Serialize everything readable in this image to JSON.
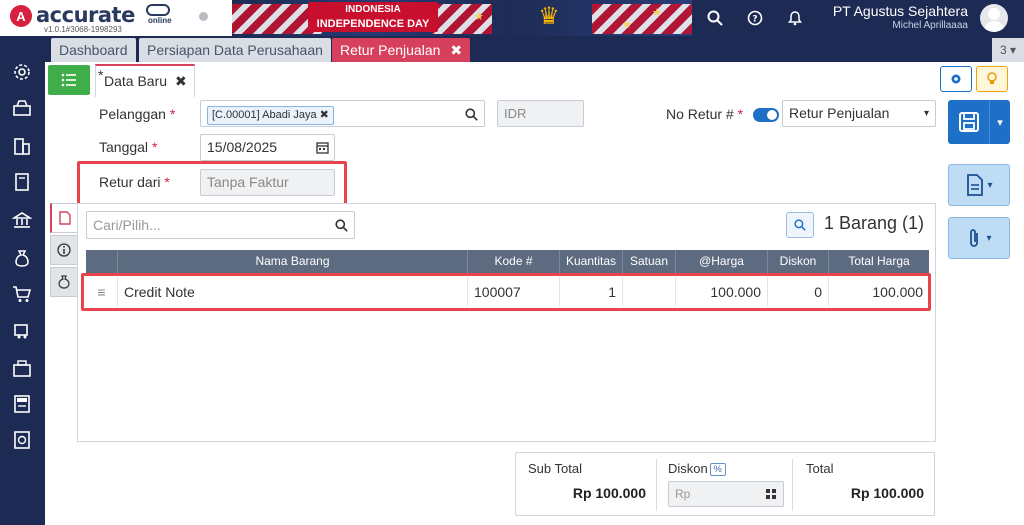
{
  "app": {
    "logo_letter": "A",
    "logo_text": "accurate",
    "logo_sub": "online",
    "version": "v1.0.1#3068-1998293",
    "banner_line1": "INDONESIA",
    "banner_line2": "INDEPENDENCE DAY",
    "company": "PT Agustus Sejahtera",
    "user": "Michel Aprillaaaa"
  },
  "tabs": [
    {
      "label": "Dashboard"
    },
    {
      "label": "Persiapan Data Perusahaan"
    },
    {
      "label": "Retur Penjualan",
      "close": "✖"
    }
  ],
  "tab_count": "3",
  "subtab": {
    "star": "*",
    "label": "Data Baru",
    "close": "✖"
  },
  "form": {
    "pelanggan_label": "Pelanggan",
    "pelanggan_value": "[C.00001] Abadi Jaya",
    "currency_placeholder": "IDR",
    "tanggal_label": "Tanggal",
    "tanggal_value": "15/08/2025",
    "retur_dari_label": "Retur dari",
    "retur_dari_value": "Tanpa Faktur",
    "no_retur_label": "No Retur #",
    "no_retur_value": "Retur Penjualan",
    "required_mark": "*"
  },
  "detail": {
    "search_placeholder": "Cari/Pilih...",
    "count_text": "1 Barang (1)",
    "columns": [
      "Nama Barang",
      "Kode #",
      "Kuantitas",
      "Satuan",
      "@Harga",
      "Diskon",
      "Total Harga"
    ],
    "rows": [
      {
        "handle": "≡",
        "nama": "Credit Note",
        "kode": "100007",
        "qty": "1",
        "satuan": "",
        "harga": "100.000",
        "diskon": "0",
        "total": "100.000"
      }
    ]
  },
  "summary": {
    "subtotal_label": "Sub Total",
    "subtotal_value": "Rp 100.000",
    "diskon_label": "Diskon",
    "diskon_pct": "%",
    "diskon_placeholder": "Rp",
    "total_label": "Total",
    "total_value": "Rp 100.000"
  },
  "colors": {
    "navy": "#1d2b54",
    "accent_pink": "#d6405c",
    "primary_blue": "#1e6fc7",
    "highlight_red": "#e8444e",
    "green": "#3fae4a"
  },
  "icons": {
    "sidebar": [
      "settings-icon",
      "inbox-icon",
      "building-icon",
      "book-icon",
      "bank-icon",
      "money-bag-icon",
      "cart-icon",
      "purchase-icon",
      "warehouse-icon",
      "tax-icon",
      "report-icon"
    ]
  }
}
